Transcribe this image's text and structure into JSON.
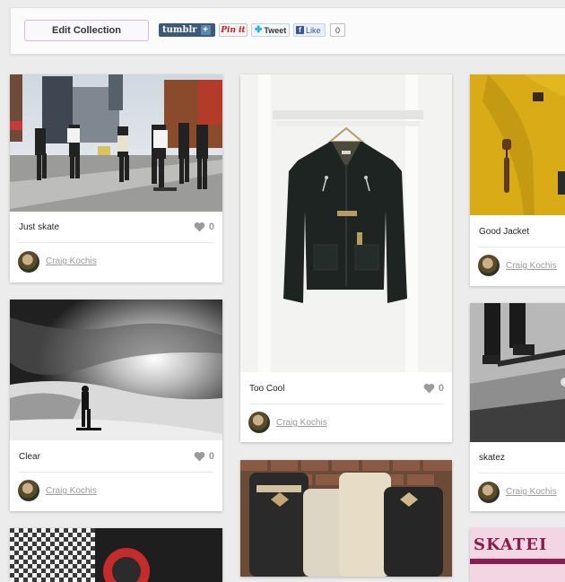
{
  "toolbar": {
    "edit_label": "Edit Collection",
    "tumblr_label": "tumblr",
    "tumblr_plus": "+",
    "pinit_label": "Pin it",
    "tweet_label": "Tweet",
    "like_label": "Like",
    "like_count": "0"
  },
  "pins": [
    {
      "caption": "Just skate",
      "likes": "0",
      "author": "Craig Kochis"
    },
    {
      "caption": "Too Cool",
      "likes": "0",
      "author": "Craig Kochis"
    },
    {
      "caption": "Good Jacket",
      "likes": "",
      "author": "Craig Kochis"
    },
    {
      "caption": "Clear",
      "likes": "0",
      "author": "Craig Kochis"
    },
    {
      "caption": "skatez",
      "likes": "",
      "author": "Craig Kochis"
    }
  ],
  "partial_sign": {
    "text": "SKATEI"
  },
  "colors": {
    "heart": "#9a9a9a",
    "accent_border": "#d9b9e8",
    "link": "#9a9a9a"
  }
}
